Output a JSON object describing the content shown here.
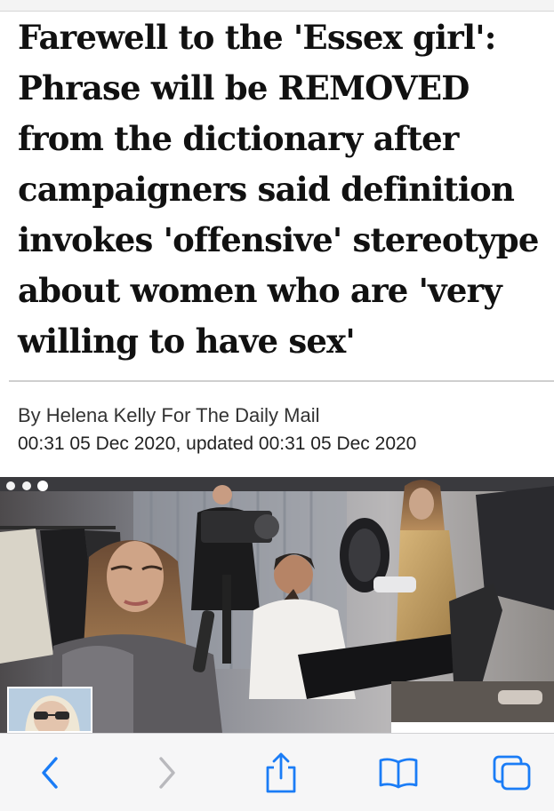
{
  "article": {
    "headline": "Farewell to the 'Essex girl': Phrase will be REMOVED from the dictionary after campaigners said definition invokes 'offensive' stereotype about women who are 'very willing to have sex'",
    "byline": "By Helena Kelly For The Daily Mail",
    "dateline": "00:31 05 Dec 2020, updated 00:31 05 Dec 2020"
  },
  "toolbar": {
    "buttons": [
      {
        "icon": "back-chevron-icon",
        "state": "enabled"
      },
      {
        "icon": "forward-chevron-icon",
        "state": "disabled"
      },
      {
        "icon": "share-icon",
        "state": "enabled"
      },
      {
        "icon": "bookmarks-icon",
        "state": "enabled"
      },
      {
        "icon": "tabs-icon",
        "state": "enabled"
      }
    ]
  },
  "colors": {
    "accent": "#1a7cf6",
    "disabled": "#b9b9bd",
    "headline": "#111111",
    "text": "#333333"
  }
}
